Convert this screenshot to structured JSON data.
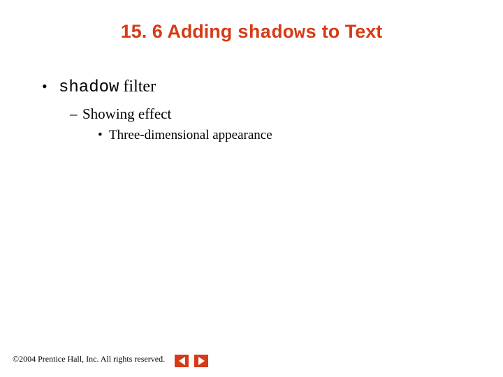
{
  "title": {
    "prefix": "15. 6  Adding ",
    "code": "shadows",
    "suffix": " to Text"
  },
  "outline": {
    "lvl1": {
      "bullet": "•",
      "code": "shadow",
      "rest": " filter"
    },
    "lvl2": {
      "dash": "–",
      "text": "Showing effect"
    },
    "lvl3": {
      "dot": "•",
      "text": "Three-dimensional appearance"
    }
  },
  "footer": {
    "copyright_symbol": "©",
    "text": " 2004 Prentice Hall, Inc.  All rights reserved."
  }
}
